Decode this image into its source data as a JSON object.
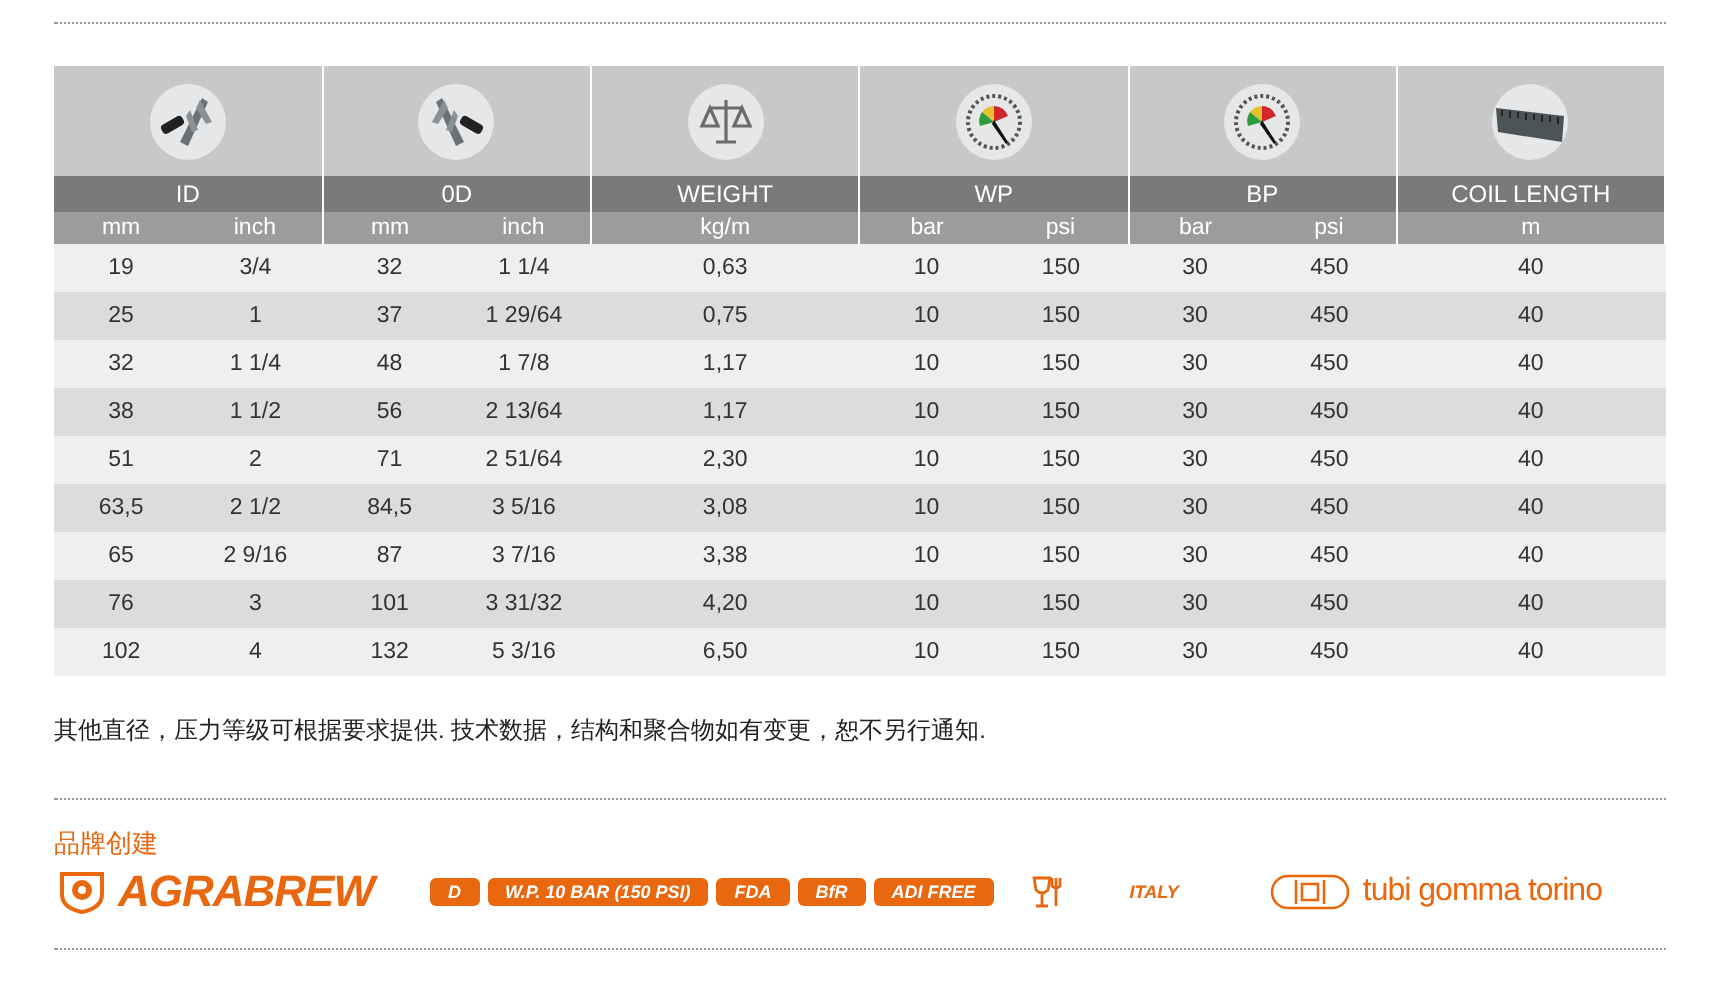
{
  "table": {
    "groups": [
      {
        "kind": "caliper",
        "title": "ID",
        "units": [
          "mm",
          "inch"
        ]
      },
      {
        "kind": "caliperod",
        "title": "0D",
        "units": [
          "mm",
          "inch"
        ]
      },
      {
        "kind": "scale",
        "title": "WEIGHT",
        "units": [
          "kg/m"
        ]
      },
      {
        "kind": "gauge",
        "title": "WP",
        "units": [
          "bar",
          "psi"
        ]
      },
      {
        "kind": "gauge",
        "title": "BP",
        "units": [
          "bar",
          "psi"
        ]
      },
      {
        "kind": "tape",
        "title": "COIL LENGTH",
        "units": [
          "m"
        ]
      }
    ],
    "rows": [
      [
        "19",
        "3/4",
        "32",
        "1 1/4",
        "0,63",
        "10",
        "150",
        "30",
        "450",
        "40"
      ],
      [
        "25",
        "1",
        "37",
        "1 29/64",
        "0,75",
        "10",
        "150",
        "30",
        "450",
        "40"
      ],
      [
        "32",
        "1 1/4",
        "48",
        "1 7/8",
        "1,17",
        "10",
        "150",
        "30",
        "450",
        "40"
      ],
      [
        "38",
        "1 1/2",
        "56",
        "2 13/64",
        "1,17",
        "10",
        "150",
        "30",
        "450",
        "40"
      ],
      [
        "51",
        "2",
        "71",
        "2 51/64",
        "2,30",
        "10",
        "150",
        "30",
        "450",
        "40"
      ],
      [
        "63,5",
        "2 1/2",
        "84,5",
        "3 5/16",
        "3,08",
        "10",
        "150",
        "30",
        "450",
        "40"
      ],
      [
        "65",
        "2 9/16",
        "87",
        "3 7/16",
        "3,38",
        "10",
        "150",
        "30",
        "450",
        "40"
      ],
      [
        "76",
        "3",
        "101",
        "3 31/32",
        "4,20",
        "10",
        "150",
        "30",
        "450",
        "40"
      ],
      [
        "102",
        "4",
        "132",
        "5 3/16",
        "6,50",
        "10",
        "150",
        "30",
        "450",
        "40"
      ]
    ]
  },
  "note": "其他直径，压力等级可根据要求提供. 技术数据，结构和聚合物如有变更，恕不另行通知.",
  "brand": {
    "label": "品牌创建",
    "name": "AGRABREW",
    "badges": [
      "D",
      "**W.P. 10 BAR** (150 PSI)",
      "FDA",
      "BfR",
      "**ADI** FREE"
    ],
    "origin": "ITALY",
    "maker": "tubi gomma torino"
  }
}
